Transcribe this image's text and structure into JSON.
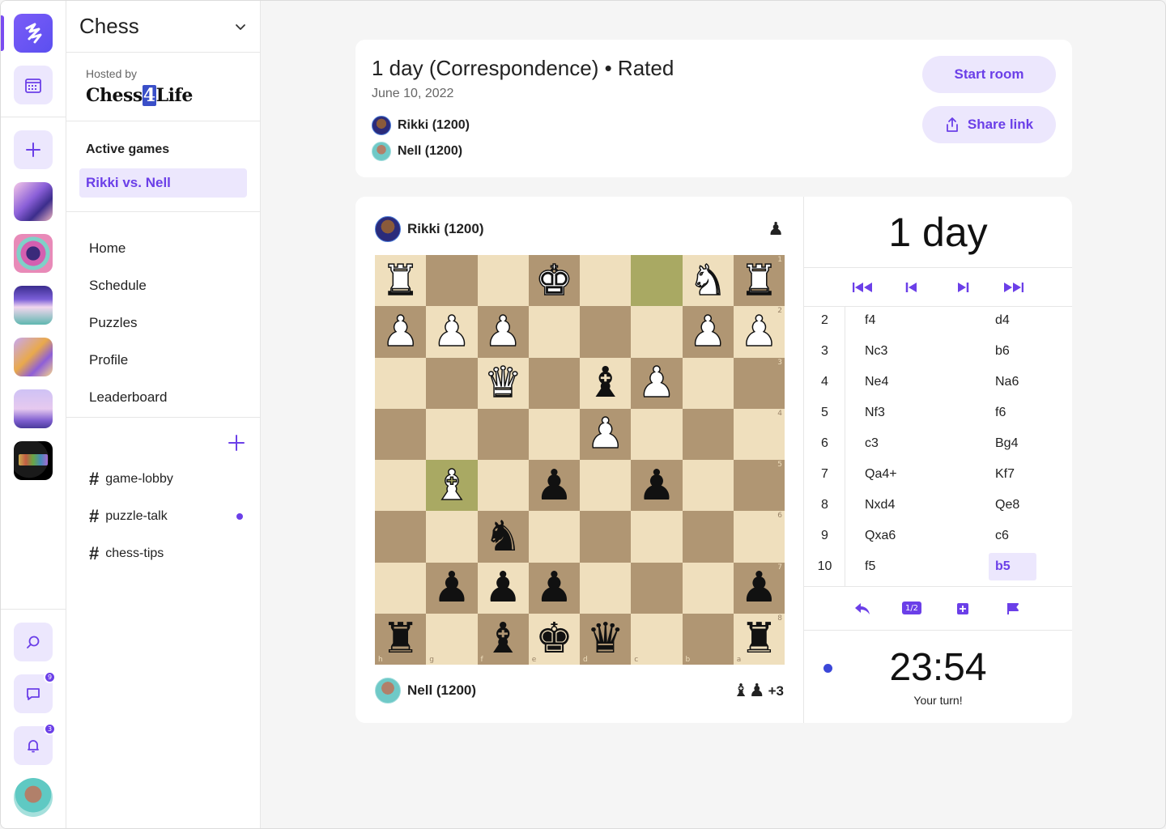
{
  "sidebar": {
    "title": "Chess",
    "hosted_label": "Hosted by",
    "hosted_brand_a": "Chess",
    "hosted_brand_b": "4",
    "hosted_brand_c": "Life",
    "active_title": "Active games",
    "active_game": "Rikki vs. Nell",
    "nav": [
      "Home",
      "Schedule",
      "Puzzles",
      "Profile",
      "Leaderboard"
    ],
    "channels": [
      {
        "name": "game-lobby",
        "unread": false
      },
      {
        "name": "puzzle-talk",
        "unread": true
      },
      {
        "name": "chess-tips",
        "unread": false
      }
    ]
  },
  "rail": {
    "messages_badge": "9",
    "notifications_badge": "3"
  },
  "game": {
    "title": "1 day (Correspondence) • Rated",
    "date": "June 10, 2022",
    "player_top": "Rikki (1200)",
    "player_bottom": "Nell (1200)",
    "start_label": "Start room",
    "share_label": "Share link"
  },
  "board": {
    "top_player": "Rikki (1200)",
    "top_captured": "♟",
    "bottom_player": "Nell (1200)",
    "bottom_captured": "♝♟",
    "bottom_advantage": "+3",
    "rows": [
      [
        "wR",
        "",
        "",
        "wK",
        "",
        "",
        "wN",
        "wR"
      ],
      [
        "wP",
        "wP",
        "wP",
        "",
        "",
        "",
        "wP",
        "wP"
      ],
      [
        "",
        "",
        "wQ",
        "",
        "bB",
        "wP",
        "",
        ""
      ],
      [
        "",
        "",
        "",
        "",
        "wP",
        "",
        "",
        ""
      ],
      [
        "",
        "wB",
        "",
        "bP",
        "",
        "bP",
        "",
        ""
      ],
      [
        "",
        "",
        "bN",
        "",
        "",
        "",
        "",
        ""
      ],
      [
        "",
        "bP",
        "bP",
        "bP",
        "",
        "",
        "",
        "bP"
      ],
      [
        "bR",
        "",
        "bB",
        "bK",
        "bQ",
        "",
        "",
        "bR"
      ]
    ],
    "highlights": [
      [
        0,
        5
      ],
      [
        4,
        1
      ]
    ],
    "rank_labels": [
      "1",
      "2",
      "3",
      "4",
      "5",
      "6",
      "7",
      "8"
    ],
    "file_labels": [
      "h",
      "g",
      "f",
      "e",
      "d",
      "c",
      "b",
      "a"
    ]
  },
  "panel": {
    "time_control": "1 day",
    "moves": [
      {
        "n": "2",
        "w": "f4",
        "b": "d4"
      },
      {
        "n": "3",
        "w": "Nc3",
        "b": "b6"
      },
      {
        "n": "4",
        "w": "Ne4",
        "b": "Na6"
      },
      {
        "n": "5",
        "w": "Nf3",
        "b": "f6"
      },
      {
        "n": "6",
        "w": "c3",
        "b": "Bg4"
      },
      {
        "n": "7",
        "w": "Qa4+",
        "b": "Kf7"
      },
      {
        "n": "8",
        "w": "Nxd4",
        "b": "Qe8"
      },
      {
        "n": "9",
        "w": "Qxa6",
        "b": "c6"
      },
      {
        "n": "10",
        "w": "f5",
        "b": "b5"
      }
    ],
    "draw_label": "1/2",
    "clock": "23:54",
    "turn_text": "Your turn!"
  },
  "colors": {
    "accent": "#6b3fe8",
    "accent_soft": "#ece7fd",
    "board_light": "#efdfbd",
    "board_dark": "#b09673",
    "board_highlight": "#a9a963"
  }
}
